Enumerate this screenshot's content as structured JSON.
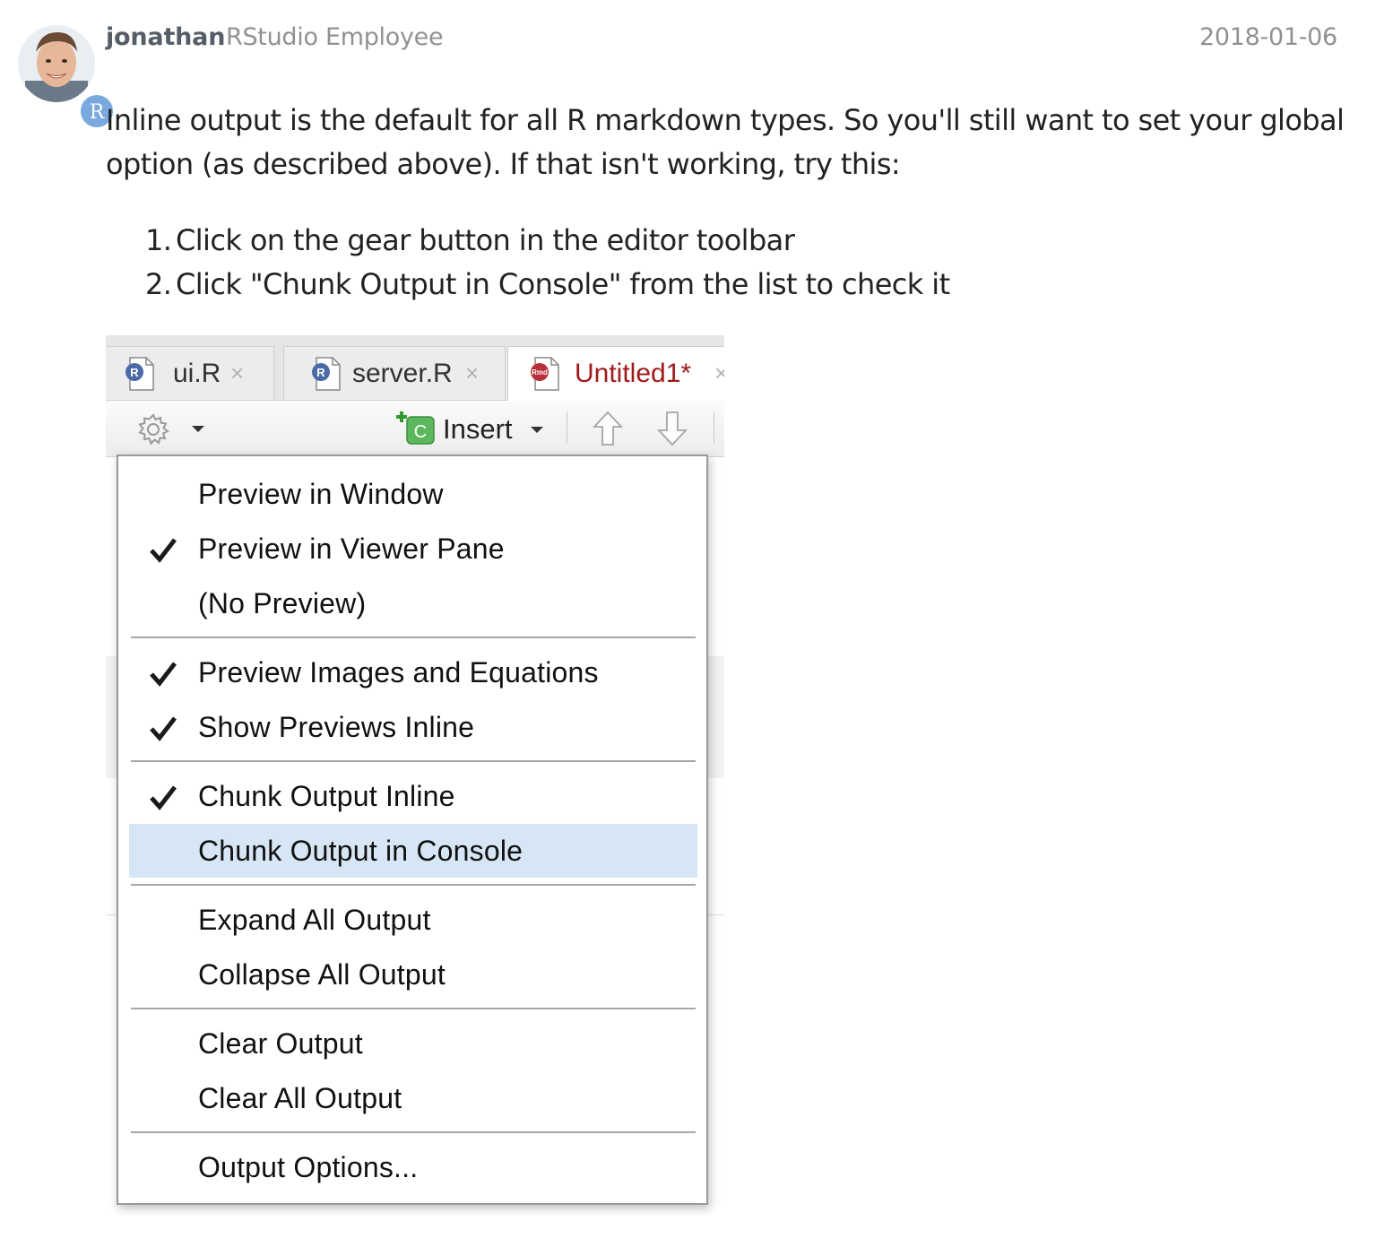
{
  "post": {
    "username": "jonathan",
    "user_title": "RStudio Employee",
    "date": "2018-01-06",
    "avatar_badge": "R",
    "paragraph": "Inline output is the default for all R markdown types. So you'll still want to set your global option (as described above). If that isn't working, try this:",
    "steps": [
      {
        "num": "1.",
        "text": "Click on the gear button in the editor toolbar"
      },
      {
        "num": "2.",
        "text": "Click \"Chunk Output in Console\" from the list to check it"
      }
    ]
  },
  "screenshot": {
    "tabs": [
      {
        "label": "ui.R",
        "icon": "r-script-file-icon",
        "close": "×"
      },
      {
        "label": "server.R",
        "icon": "r-script-file-icon",
        "close": "×"
      },
      {
        "label": "Untitled1*",
        "icon": "rmarkdown-file-icon",
        "close": "×",
        "active": true
      }
    ],
    "toolbar": {
      "gear_icon": "gear-icon",
      "insert_label": "Insert",
      "insert_icon": "insert-chunk-icon",
      "up_icon": "arrow-up-icon",
      "down_icon": "arrow-down-icon"
    },
    "menu": {
      "groups": [
        [
          {
            "label": "Preview in Window",
            "checked": false
          },
          {
            "label": "Preview in Viewer Pane",
            "checked": true
          },
          {
            "label": "(No Preview)",
            "checked": false
          }
        ],
        [
          {
            "label": "Preview Images and Equations",
            "checked": true
          },
          {
            "label": "Show Previews Inline",
            "checked": true
          }
        ],
        [
          {
            "label": "Chunk Output Inline",
            "checked": true
          },
          {
            "label": "Chunk Output in Console",
            "checked": false,
            "highlighted": true
          }
        ],
        [
          {
            "label": "Expand All Output",
            "checked": false
          },
          {
            "label": "Collapse All Output",
            "checked": false
          }
        ],
        [
          {
            "label": "Clear Output",
            "checked": false
          },
          {
            "label": "Clear All Output",
            "checked": false
          }
        ],
        [
          {
            "label": "Output Options...",
            "checked": false
          }
        ]
      ]
    },
    "colors": {
      "highlight": "#d6e6f5",
      "active_tab_text": "#a11a1a",
      "badge": "#7aa9e0"
    }
  }
}
